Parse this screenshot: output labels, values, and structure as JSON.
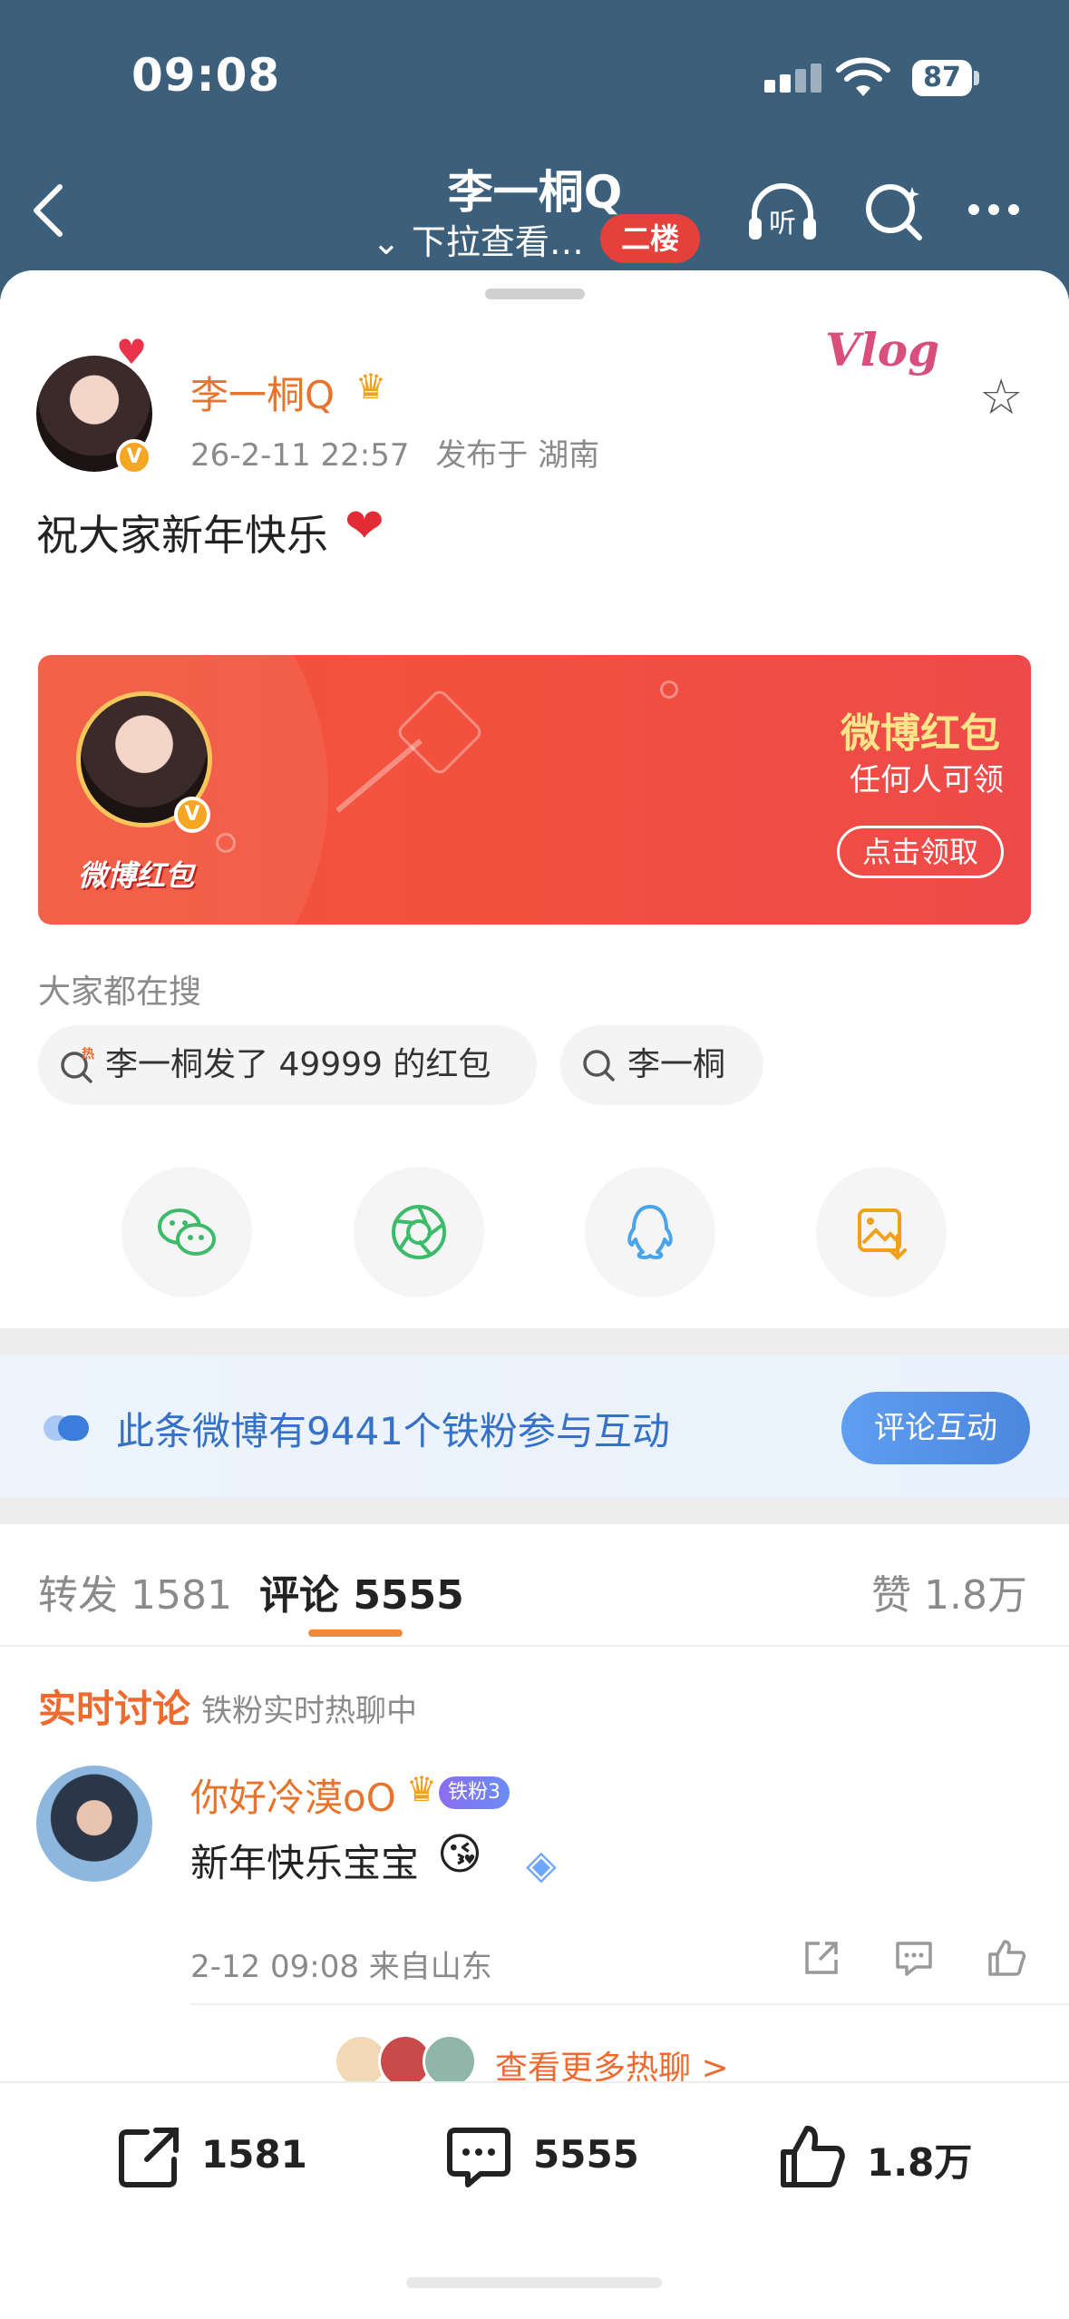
{
  "status_bar": {
    "time": "09:08",
    "battery": "87"
  },
  "nav": {
    "title": "李一桐Q",
    "subtitle": "⌄ 下拉查看…",
    "floor_badge": "二楼",
    "listen_icon_text": "听"
  },
  "post": {
    "username": "李一桐Q",
    "date": "26-2-11 22:57",
    "location": "发布于 湖南",
    "text": "祝大家新年快乐",
    "vlog_label": "Vlog"
  },
  "red_packet": {
    "title": "微博红包",
    "subtitle": "任何人可领",
    "button": "点击领取",
    "logo": "微博红包"
  },
  "search": {
    "label": "大家都在搜",
    "chips": [
      {
        "text": "李一桐发了 49999 的红包",
        "hot": "热"
      },
      {
        "text": "李一桐"
      }
    ]
  },
  "fans_banner": {
    "text": "此条微博有9441个铁粉参与互动",
    "button": "评论互动"
  },
  "tabs": {
    "repost": "转发 1581",
    "comments": "评论 5555",
    "likes": "赞 1.8万"
  },
  "live": {
    "title": "实时讨论",
    "subtitle": "铁粉实时热聊中",
    "more": "查看更多热聊 >"
  },
  "comment": {
    "username": "你好冷漠oO",
    "fan_badge": "铁粉3",
    "text": "新年快乐宝宝",
    "meta": "2-12 09:08 来自山东"
  },
  "bottom_bar": {
    "reposts": "1581",
    "comments": "5555",
    "likes": "1.8万"
  },
  "colors": {
    "header": "#3c5f7c",
    "accent_orange": "#e8732c",
    "packet_red": "#f2503f",
    "link_blue": "#3572c7"
  }
}
